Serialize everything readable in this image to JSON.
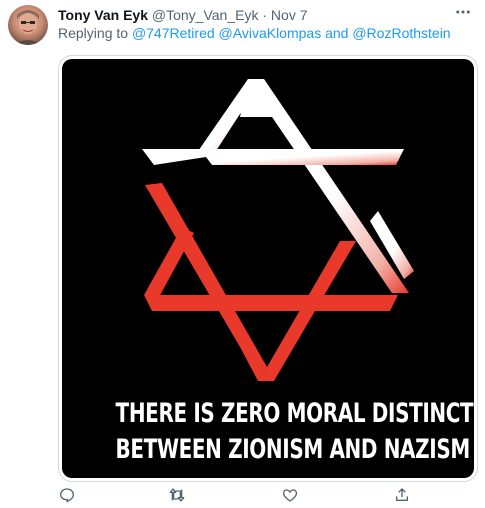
{
  "tweet": {
    "author_name": "Tony Van Eyk",
    "author_handle": "@Tony_Van_Eyk",
    "separator": "·",
    "date": "Nov 7",
    "reply_prefix": "Replying to",
    "reply_to_1": "@747Retired",
    "reply_to_2": "@AvivaKlompas",
    "reply_and": "and",
    "reply_to_3": "@RozRothstein",
    "media": {
      "caption_line_1": "THERE IS ZERO MORAL DISTINCTION",
      "caption_line_2": "BETWEEN ZIONISM AND NAZISM"
    }
  },
  "icons": {
    "more": "more-horizontal-icon",
    "reply": "reply-icon",
    "retweet": "retweet-icon",
    "like": "heart-icon",
    "share": "share-icon"
  },
  "colors": {
    "link": "#1d9bf0",
    "muted": "#536471",
    "star_white": "#ffffff",
    "star_red": "#e8392b",
    "media_background": "#000000"
  }
}
